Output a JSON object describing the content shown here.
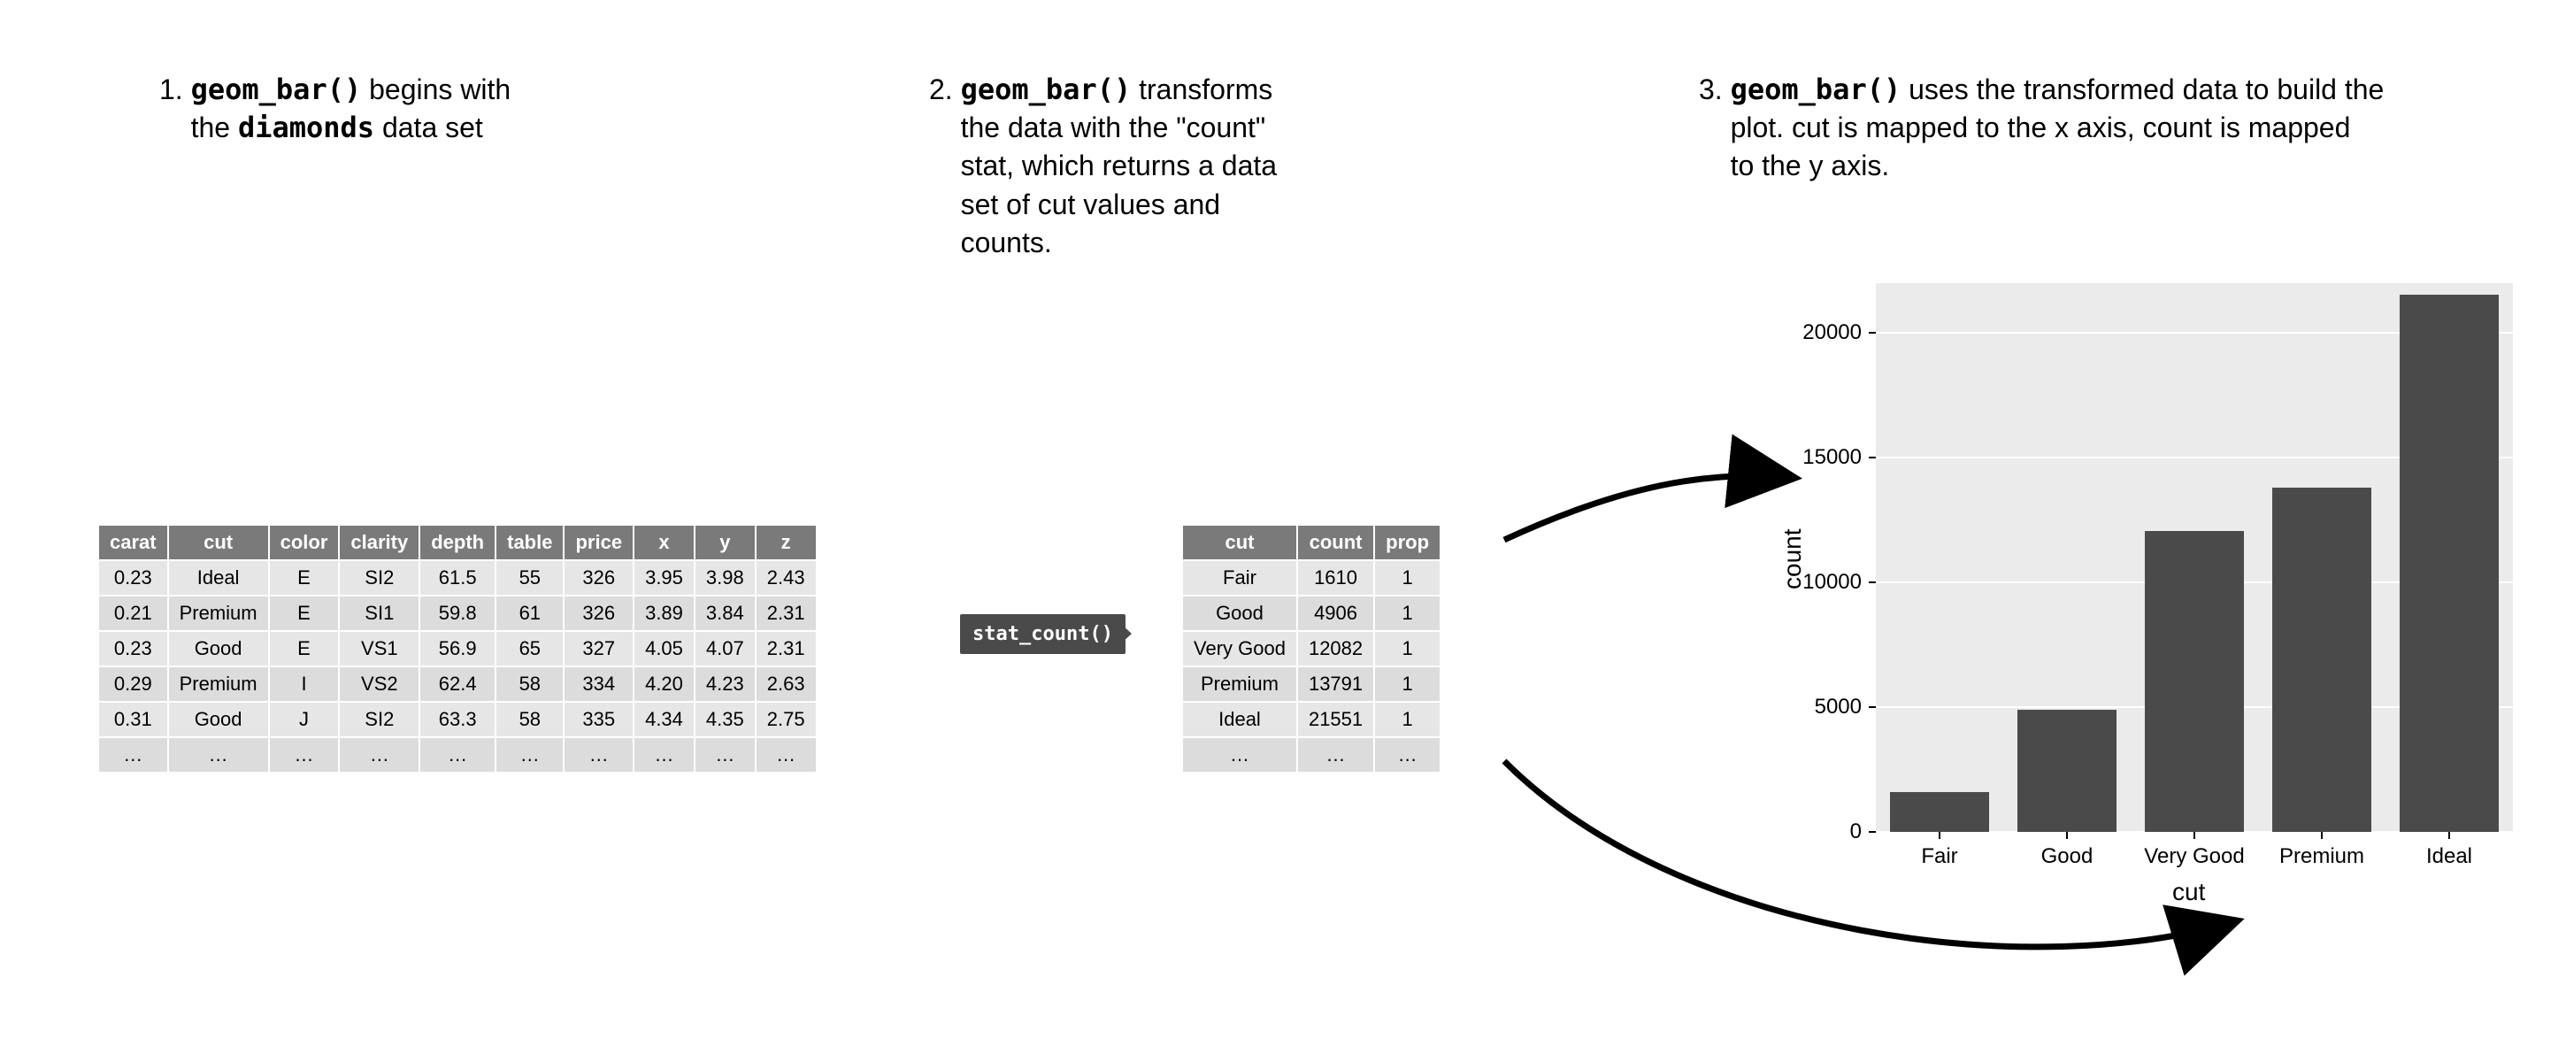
{
  "steps": {
    "s1": {
      "num": "1.",
      "code": "geom_bar()",
      "t1": " begins with",
      "t2": "the ",
      "bold": "diamonds",
      "t3": " data set"
    },
    "s2": {
      "num": "2.",
      "code": "geom_bar()",
      "t1": " transforms",
      "t2": "the data with the \"count\"",
      "t3": "stat, which returns a data",
      "t4": "set of cut values and",
      "t5": "counts."
    },
    "s3": {
      "num": "3.",
      "code": "geom_bar()",
      "t1": " uses the transformed data to build the",
      "t2": "plot. cut is mapped to the x axis, count is mapped",
      "t3": "to the y axis."
    }
  },
  "stat_label": "stat_count()",
  "diamonds": {
    "headers": [
      "carat",
      "cut",
      "color",
      "clarity",
      "depth",
      "table",
      "price",
      "x",
      "y",
      "z"
    ],
    "rows": [
      [
        "0.23",
        "Ideal",
        "E",
        "SI2",
        "61.5",
        "55",
        "326",
        "3.95",
        "3.98",
        "2.43"
      ],
      [
        "0.21",
        "Premium",
        "E",
        "SI1",
        "59.8",
        "61",
        "326",
        "3.89",
        "3.84",
        "2.31"
      ],
      [
        "0.23",
        "Good",
        "E",
        "VS1",
        "56.9",
        "65",
        "327",
        "4.05",
        "4.07",
        "2.31"
      ],
      [
        "0.29",
        "Premium",
        "I",
        "VS2",
        "62.4",
        "58",
        "334",
        "4.20",
        "4.23",
        "2.63"
      ],
      [
        "0.31",
        "Good",
        "J",
        "SI2",
        "63.3",
        "58",
        "335",
        "4.34",
        "4.35",
        "2.75"
      ],
      [
        "…",
        "…",
        "…",
        "…",
        "…",
        "…",
        "…",
        "…",
        "…",
        "…"
      ]
    ]
  },
  "counts": {
    "headers": [
      "cut",
      "count",
      "prop"
    ],
    "rows": [
      [
        "Fair",
        "1610",
        "1"
      ],
      [
        "Good",
        "4906",
        "1"
      ],
      [
        "Very Good",
        "12082",
        "1"
      ],
      [
        "Premium",
        "13791",
        "1"
      ],
      [
        "Ideal",
        "21551",
        "1"
      ],
      [
        "…",
        "…",
        "…"
      ]
    ]
  },
  "chart_data": {
    "type": "bar",
    "categories": [
      "Fair",
      "Good",
      "Very Good",
      "Premium",
      "Ideal"
    ],
    "values": [
      1610,
      4906,
      12082,
      13791,
      21551
    ],
    "xlabel": "cut",
    "ylabel": "count",
    "yticks": [
      0,
      5000,
      10000,
      15000,
      20000
    ],
    "ylim": [
      0,
      22000
    ]
  }
}
